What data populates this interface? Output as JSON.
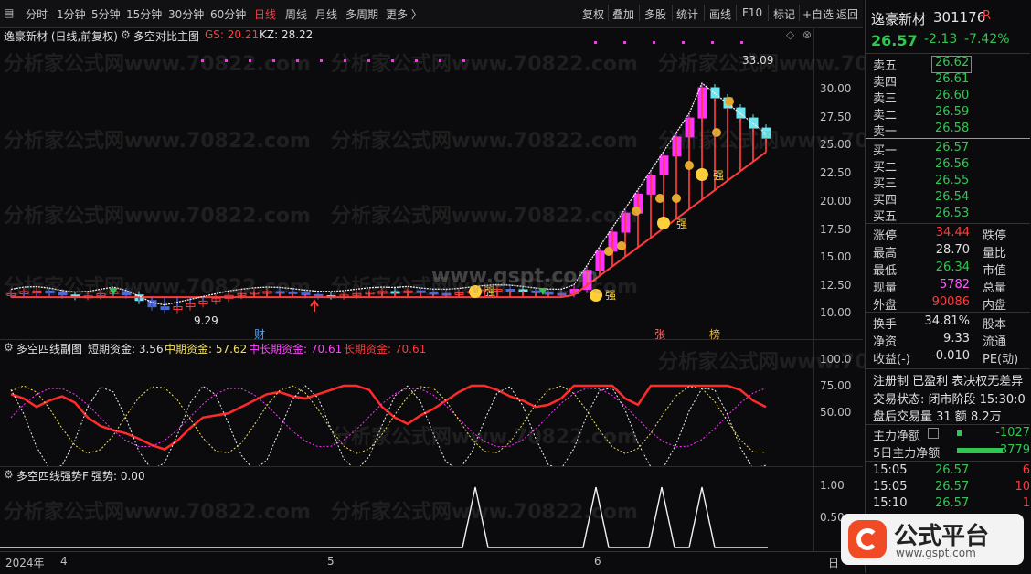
{
  "toolbar": {
    "periods": [
      "分时",
      "1分钟",
      "5分钟",
      "15分钟",
      "30分钟",
      "60分钟",
      "日线",
      "周线",
      "月线",
      "多周期",
      "更多 〉"
    ],
    "active_period": "日线",
    "right_buttons": [
      "复权",
      "叠加",
      "多股",
      "统计",
      "画线",
      "F10",
      "标记",
      "+自选",
      "返回"
    ]
  },
  "main_chart": {
    "stock_title": "逸豪新材 (日线,前复权)",
    "indicator": "多空对比主图",
    "gs_label": "GS: 20.21",
    "kz_label": "KZ: 28.22",
    "high_label": "33.09",
    "low_label": "9.29",
    "strong_label": "强",
    "markers": {
      "cai": "财",
      "zhang": "张",
      "bang": "榜"
    }
  },
  "sub1": {
    "title": "多空四线副图",
    "short": "短期资金: 3.56",
    "mid": "中期资金: 57.62",
    "midlong": "中长期资金: 70.61",
    "long": "长期资金: 70.61"
  },
  "sub2": {
    "title": "多空四线强势F",
    "strength": "强势: 0.00"
  },
  "date_axis": {
    "year": "2024年",
    "m4": "4",
    "m5": "5",
    "m6": "6",
    "end": "日"
  },
  "colors": {
    "up": "#ff3b3b",
    "down": "#2ec850",
    "magenta": "#ff33ff",
    "cyan": "#6ee8f0",
    "bg": "#0b0b0d"
  },
  "watermark": "分析家公式网www.70822.com",
  "watermark2": "www.gspt.com",
  "side": {
    "name": "逸豪新材",
    "code": "301176",
    "r_badge": "R",
    "price": "26.57",
    "change": "-2.13",
    "pct": "-7.42%",
    "asks": [
      {
        "label": "卖五",
        "price": "26.62"
      },
      {
        "label": "卖四",
        "price": "26.61"
      },
      {
        "label": "卖三",
        "price": "26.60"
      },
      {
        "label": "卖二",
        "price": "26.59"
      },
      {
        "label": "卖一",
        "price": "26.58"
      }
    ],
    "bids": [
      {
        "label": "买一",
        "price": "26.57"
      },
      {
        "label": "买二",
        "price": "26.56"
      },
      {
        "label": "买三",
        "price": "26.55"
      },
      {
        "label": "买四",
        "price": "26.54"
      },
      {
        "label": "买五",
        "price": "26.53"
      }
    ],
    "stats": [
      {
        "l1": "涨停",
        "v1": "34.44",
        "c1": "r",
        "l2": "跌停"
      },
      {
        "l1": "最高",
        "v1": "28.70",
        "c1": "w",
        "l2": "量比"
      },
      {
        "l1": "最低",
        "v1": "26.34",
        "c1": "g",
        "l2": "市值"
      },
      {
        "l1": "现量",
        "v1": "5782",
        "c1": "m",
        "l2": "总量"
      },
      {
        "l1": "外盘",
        "v1": "90086",
        "c1": "r",
        "l2": "内盘"
      }
    ],
    "stats2": [
      {
        "l1": "换手",
        "v1": "34.81%",
        "l2": "股本"
      },
      {
        "l1": "净资",
        "v1": "9.33",
        "l2": "流通"
      },
      {
        "l1": "收益(-)",
        "v1": "-0.010",
        "l2": "PE(动)"
      }
    ],
    "reg": "注册制 已盈利 表决权无差异",
    "trade_state": "交易状态: 闭市阶段 15:30:0",
    "after_hours": "盘后交易量 31 额 8.2万",
    "main_net": "主力净额",
    "main_net_val": "-1027",
    "main_net5": "5日主力净额",
    "main_net5_val": "-3779",
    "ticks": [
      {
        "t": "15:05",
        "p": "26.57",
        "v": "6"
      },
      {
        "t": "15:05",
        "p": "26.57",
        "v": "10"
      },
      {
        "t": "15:10",
        "p": "26.57",
        "v": "1"
      }
    ]
  },
  "logo": {
    "text": "公式平台",
    "url": "www.gspt.com"
  }
}
